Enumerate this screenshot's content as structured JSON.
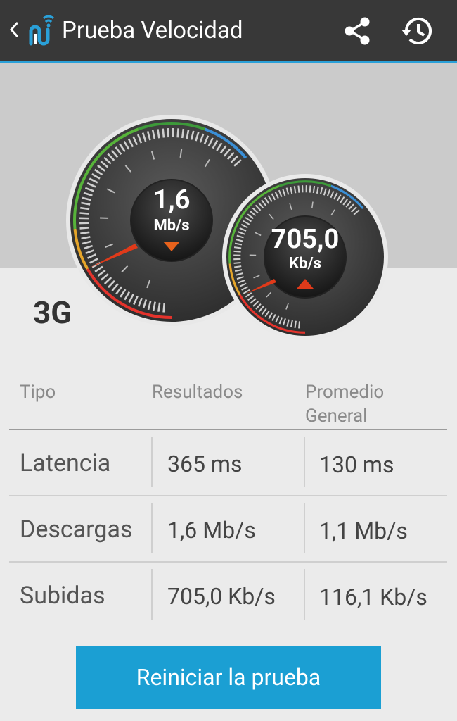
{
  "app": {
    "title": "Prueba Velocidad",
    "accent": "#2aa0d8"
  },
  "toolbar": {
    "icons": [
      "back-chevron-icon",
      "app-logo-icon",
      "share-icon",
      "history-icon"
    ]
  },
  "gauges": {
    "download": {
      "value": "1,6",
      "unit": "Mb/s",
      "direction": "down",
      "indicator_color": "#e8621c"
    },
    "upload": {
      "value": "705,0",
      "unit": "Kb/s",
      "direction": "up",
      "indicator_color": "#e03a1a"
    }
  },
  "network_type": "3G",
  "table": {
    "headers": [
      "Tipo",
      "Resultados",
      "Promedio General"
    ],
    "rows": [
      {
        "type": "Latencia",
        "result": "365 ms",
        "average": "130 ms"
      },
      {
        "type": "Descargas",
        "result": "1,6 Mb/s",
        "average": "1,1 Mb/s"
      },
      {
        "type": "Subidas",
        "result": "705,0 Kb/s",
        "average": "116,1 Kb/s"
      }
    ]
  },
  "restart_button": {
    "label": "Reiniciar la prueba",
    "color": "#1b9fd3"
  }
}
